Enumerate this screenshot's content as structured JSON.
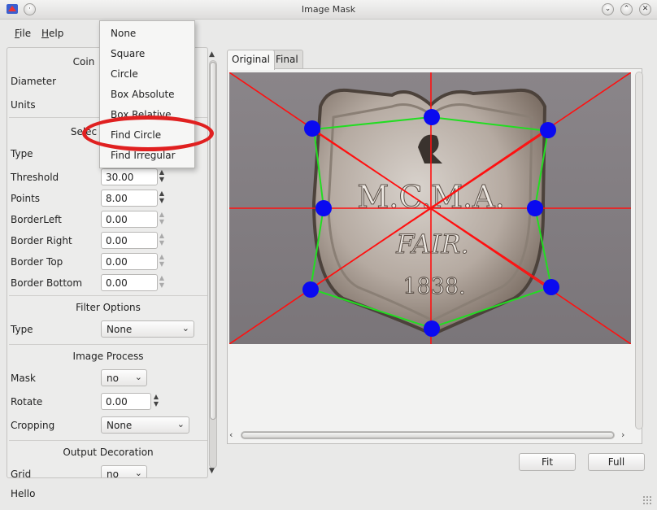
{
  "window": {
    "title": "Image Mask"
  },
  "menu": [
    {
      "label": "File",
      "mnemonic": "F",
      "rest": "ile"
    },
    {
      "label": "Help",
      "mnemonic": "H",
      "rest": "elp"
    }
  ],
  "coin": {
    "title": "Coin",
    "diameter_label": "Diameter",
    "units_label": "Units"
  },
  "selection": {
    "title_visible": "Selec",
    "type_label": "Type",
    "fields": [
      {
        "label": "Threshold",
        "value": "30.00"
      },
      {
        "label": "Points",
        "value": "8.00"
      },
      {
        "label": "BorderLeft",
        "value": "0.00"
      },
      {
        "label": "Border Right",
        "value": "0.00"
      },
      {
        "label": "Border Top",
        "value": "0.00"
      },
      {
        "label": "Border Bottom",
        "value": "0.00"
      }
    ]
  },
  "filter": {
    "title": "Filter Options",
    "type_label": "Type",
    "type_value": "None"
  },
  "image_process": {
    "title": "Image Process",
    "mask_label": "Mask",
    "mask_value": "no",
    "rotate_label": "Rotate",
    "rotate_value": "0.00",
    "cropping_label": "Cropping",
    "cropping_value": "None"
  },
  "output": {
    "title": "Output Decoration",
    "grid_label": "Grid",
    "grid_value": "no"
  },
  "tabs": [
    {
      "label": "Original",
      "active": true
    },
    {
      "label": "Final",
      "active": false
    }
  ],
  "image": {
    "text_line1": "M.C.M.A.",
    "text_line2": "FAIR.",
    "text_line3": "1838.",
    "guide_color": "#ff0000",
    "outline_color": "#22dd22",
    "handle_color": "#0a0af0"
  },
  "buttons": {
    "fit": "Fit",
    "full": "Full"
  },
  "status": {
    "text": "Hello"
  },
  "dropdown": {
    "options": [
      "None",
      "Square",
      "Circle",
      "Box Absolute",
      "Box Relative",
      "Find Circle",
      "Find Irregular"
    ],
    "circled_option": "Find Circle"
  }
}
